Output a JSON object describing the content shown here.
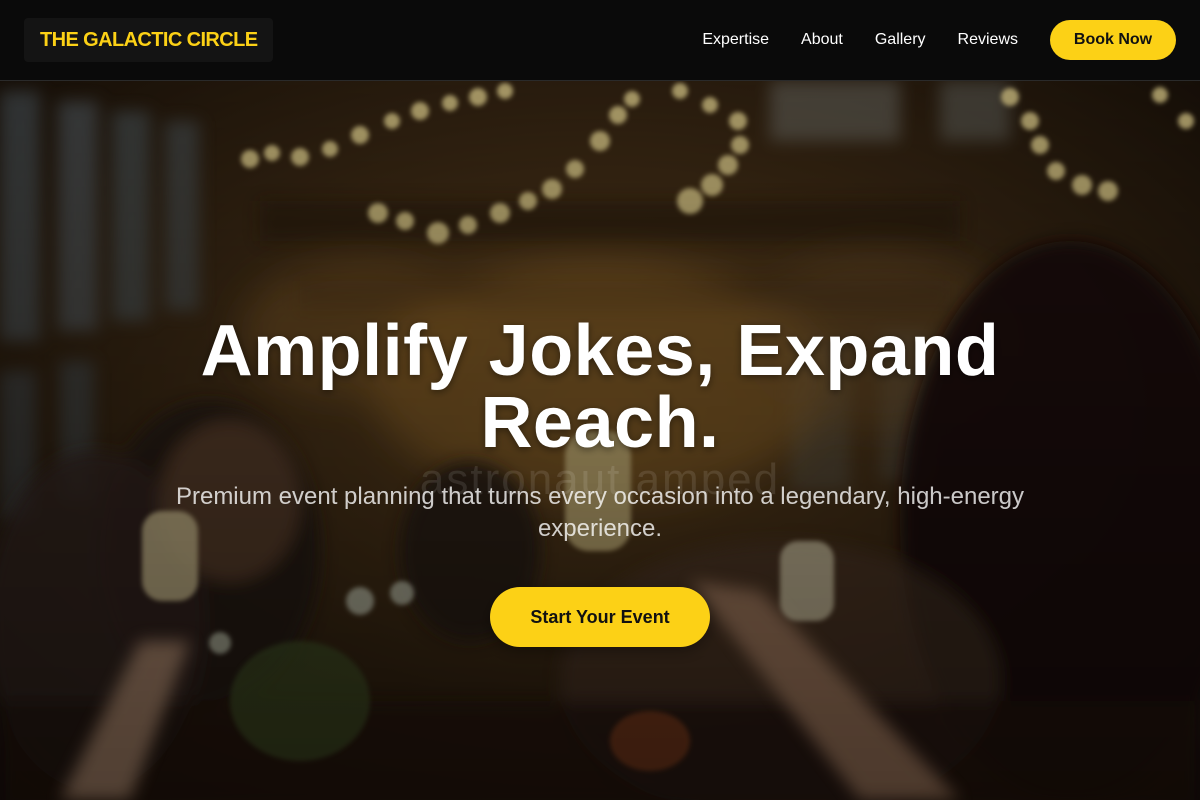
{
  "nav": {
    "logo": "THE GALACTIC CIRCLE",
    "links": [
      "Expertise",
      "About",
      "Gallery",
      "Reviews"
    ],
    "book_label": "Book Now"
  },
  "hero": {
    "headline_line1": "Amplify Jokes, Expand",
    "headline_line2": "Reach.",
    "watermark": "astronaut amped",
    "subhead": "Premium event planning that turns every occasion into a legendary, high-energy experience.",
    "cta_label": "Start Your Event",
    "background": "photo of guests raising champagne glasses at a dinner party under string lights"
  },
  "colors": {
    "accent": "#fcd116",
    "nav_bg": "#0a0a0a",
    "text": "#ffffff"
  }
}
